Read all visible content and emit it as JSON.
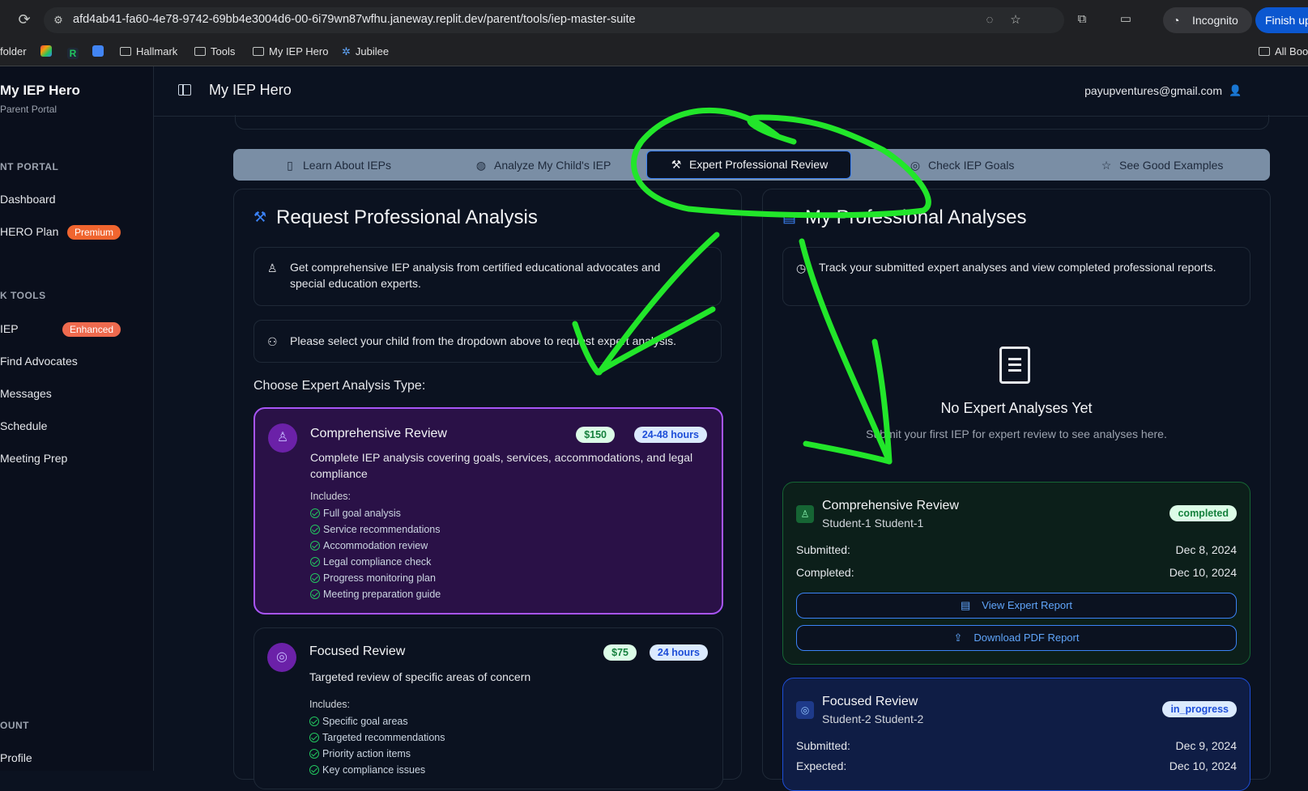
{
  "browser": {
    "url": "afd4ab41-fa60-4e78-9742-69bb4e3004d6-00-6i79wn87wfhu.janeway.replit.dev/parent/tools/iep-master-suite",
    "incognito_label": "Incognito",
    "finish_label": "Finish upd",
    "bookmarks": [
      {
        "label": "folder"
      },
      {
        "label": "Hallmark"
      },
      {
        "label": "Tools"
      },
      {
        "label": "My IEP Hero"
      },
      {
        "label": "Jubilee"
      },
      {
        "label": "All Boo"
      }
    ]
  },
  "sidebar": {
    "brand": "My IEP Hero",
    "brand_sub": "Parent Portal",
    "section_portal": "NT PORTAL",
    "dashboard": "Dashboard",
    "hero_plan": "HERO Plan",
    "premium": "Premium",
    "section_tools": "K TOOLS",
    "iep": "IEP",
    "enhanced": "Enhanced",
    "find_advocates": "Find Advocates",
    "messages": "Messages",
    "schedule": "Schedule",
    "meeting_prep": "Meeting Prep",
    "section_account": "OUNT",
    "profile": "Profile"
  },
  "header": {
    "title": "My IEP Hero",
    "email": "payupventures@gmail.com"
  },
  "tabs": [
    {
      "label": "Learn About IEPs",
      "icon": "book-icon"
    },
    {
      "label": "Analyze My Child's IEP",
      "icon": "brain-icon"
    },
    {
      "label": "Expert Professional Review",
      "icon": "gavel-icon",
      "active": true
    },
    {
      "label": "Check IEP Goals",
      "icon": "target-icon"
    },
    {
      "label": "See Good Examples",
      "icon": "star-icon"
    }
  ],
  "request": {
    "title": "Request Professional Analysis",
    "info": "Get comprehensive IEP analysis from certified educational advocates and special education experts.",
    "select_child": "Please select your child from the dropdown above to request expert analysis.",
    "choose_label": "Choose Expert Analysis Type:",
    "options": [
      {
        "title": "Comprehensive Review",
        "price": "$150",
        "time": "24-48 hours",
        "desc": "Complete IEP analysis covering goals, services, accommodations, and legal compliance",
        "includes_label": "Includes:",
        "features": [
          "Full goal analysis",
          "Service recommendations",
          "Accommodation review",
          "Legal compliance check",
          "Progress monitoring plan",
          "Meeting preparation guide"
        ]
      },
      {
        "title": "Focused Review",
        "price": "$75",
        "time": "24 hours",
        "desc": "Targeted review of specific areas of concern",
        "includes_label": "Includes:",
        "features": [
          "Specific goal areas",
          "Targeted recommendations",
          "Priority action items",
          "Key compliance issues"
        ]
      }
    ]
  },
  "analyses": {
    "title": "My Professional Analyses",
    "info": "Track your submitted expert analyses and view completed professional reports.",
    "empty_title": "No Expert Analyses Yet",
    "empty_sub": "Submit your first IEP for expert review to see analyses here.",
    "cards": [
      {
        "title": "Comprehensive Review",
        "student": "Student-1 Student-1",
        "status": "completed",
        "submitted_label": "Submitted:",
        "submitted": "Dec 8, 2024",
        "second_label": "Completed:",
        "second": "Dec 10, 2024",
        "view_btn": "View Expert Report",
        "download_btn": "Download PDF Report"
      },
      {
        "title": "Focused Review",
        "student": "Student-2 Student-2",
        "status": "in_progress",
        "submitted_label": "Submitted:",
        "submitted": "Dec 9, 2024",
        "second_label": "Expected:",
        "second": "Dec 10, 2024"
      }
    ]
  },
  "colors": {
    "annotation": "#22e62a",
    "accent": "#3b82f6",
    "premium": "#f0652f",
    "purple_card": "#2a1147"
  }
}
